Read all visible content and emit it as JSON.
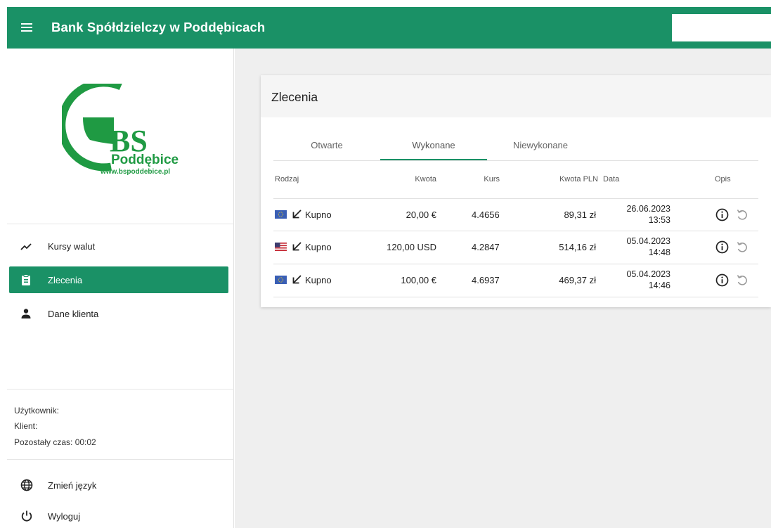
{
  "header": {
    "title": "Bank Spółdzielczy w Poddębicach",
    "search_value": ""
  },
  "logo": {
    "big": "BS",
    "name": "Poddębice",
    "url": "www.bspoddebice.pl"
  },
  "nav": [
    {
      "label": "Kursy walut",
      "icon": "trending-up-icon",
      "active": false
    },
    {
      "label": "Zlecenia",
      "icon": "clipboard-icon",
      "active": true
    },
    {
      "label": "Dane klienta",
      "icon": "person-icon",
      "active": false
    }
  ],
  "user_info": {
    "user": "Użytkownik:",
    "client": "Klient:",
    "time_left": "Pozostały czas: 00:02"
  },
  "bottom_menu": [
    {
      "label": "Zmień język",
      "icon": "globe-icon"
    },
    {
      "label": "Wyloguj",
      "icon": "power-icon"
    }
  ],
  "card": {
    "title": "Zlecenia"
  },
  "tabs": [
    {
      "label": "Otwarte",
      "active": false
    },
    {
      "label": "Wykonane",
      "active": true
    },
    {
      "label": "Niewykonane",
      "active": false
    }
  ],
  "table": {
    "headers": {
      "rodzaj": "Rodzaj",
      "kwota": "Kwota",
      "kurs": "Kurs",
      "kwota_pln": "Kwota PLN",
      "data": "Data",
      "opis": "Opis"
    },
    "rows": [
      {
        "flag": "eu-flag-icon",
        "type": "Kupno",
        "amount": "20,00 €",
        "rate": "4.4656",
        "pln": "89,31 zł",
        "date": "26.06.2023",
        "time": "13:53"
      },
      {
        "flag": "us-flag-icon",
        "type": "Kupno",
        "amount": "120,00 USD",
        "rate": "4.2847",
        "pln": "514,16 zł",
        "date": "05.04.2023",
        "time": "14:48"
      },
      {
        "flag": "eu-flag-icon",
        "type": "Kupno",
        "amount": "100,00 €",
        "rate": "4.6937",
        "pln": "469,37 zł",
        "date": "05.04.2023",
        "time": "14:46"
      }
    ]
  },
  "colors": {
    "accent": "#1a9166",
    "logo_green": "#1f9a43",
    "background": "#efefef"
  }
}
